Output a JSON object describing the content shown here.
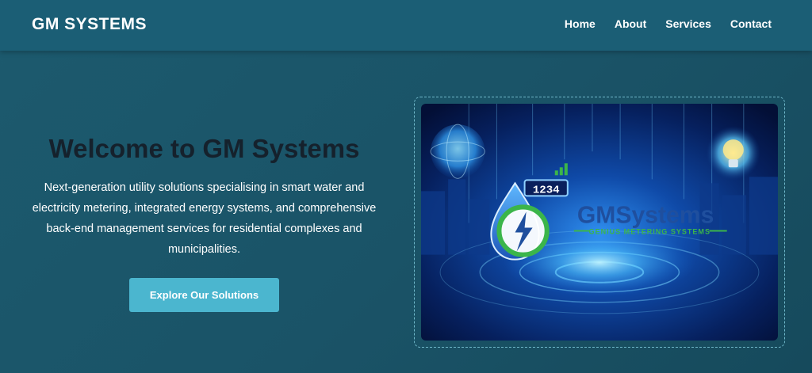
{
  "nav": {
    "brand": "GM SYSTEMS",
    "links": [
      "Home",
      "About",
      "Services",
      "Contact"
    ]
  },
  "hero": {
    "title": "Welcome to GM Systems",
    "description": "Next-generation utility solutions specialising in smart water and electricity metering, integrated energy systems, and comprehensive back-end management services for residential complexes and municipalities.",
    "cta_label": "Explore Our Solutions"
  },
  "image": {
    "meter_reading": "1234",
    "logo_gm": "GM",
    "logo_systems": "Systems",
    "tagline": "GENIUS METERING SYSTEMS",
    "icons": [
      "globe-icon",
      "lightbulb-icon",
      "water-drop-icon",
      "lightning-bolt-icon",
      "signal-bars-icon"
    ]
  },
  "colors": {
    "background": "#1a5367",
    "navbar": "#1b5e75",
    "title_text": "#15212c",
    "cta_button": "#4bb6cf",
    "frame_border": "#6fb7c9",
    "logo_blue": "#1f4f9e",
    "logo_green": "#3bb54a"
  }
}
